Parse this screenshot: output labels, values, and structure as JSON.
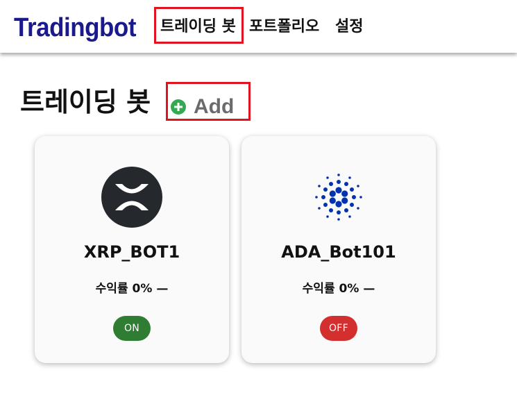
{
  "navbar": {
    "brand": "Tradingbot",
    "items": [
      {
        "label": "트레이딩 봇"
      },
      {
        "label": "포트폴리오"
      },
      {
        "label": "설정"
      }
    ]
  },
  "main": {
    "title": "트레이딩 봇",
    "add_label": "Add"
  },
  "bots": [
    {
      "name": "XRP_BOT1",
      "profit_label": "수익률",
      "profit_value": "0%",
      "trend": "—",
      "status": "ON",
      "status_color": "#2e7d32",
      "icon": "xrp-logo-icon"
    },
    {
      "name": "ADA_Bot101",
      "profit_label": "수익률",
      "profit_value": "0%",
      "trend": "—",
      "status": "OFF",
      "status_color": "#d32f2f",
      "icon": "cardano-logo-icon"
    }
  ],
  "colors": {
    "brand": "#1a1a8c",
    "highlight": "#e0141e",
    "add_icon": "#34a853"
  }
}
